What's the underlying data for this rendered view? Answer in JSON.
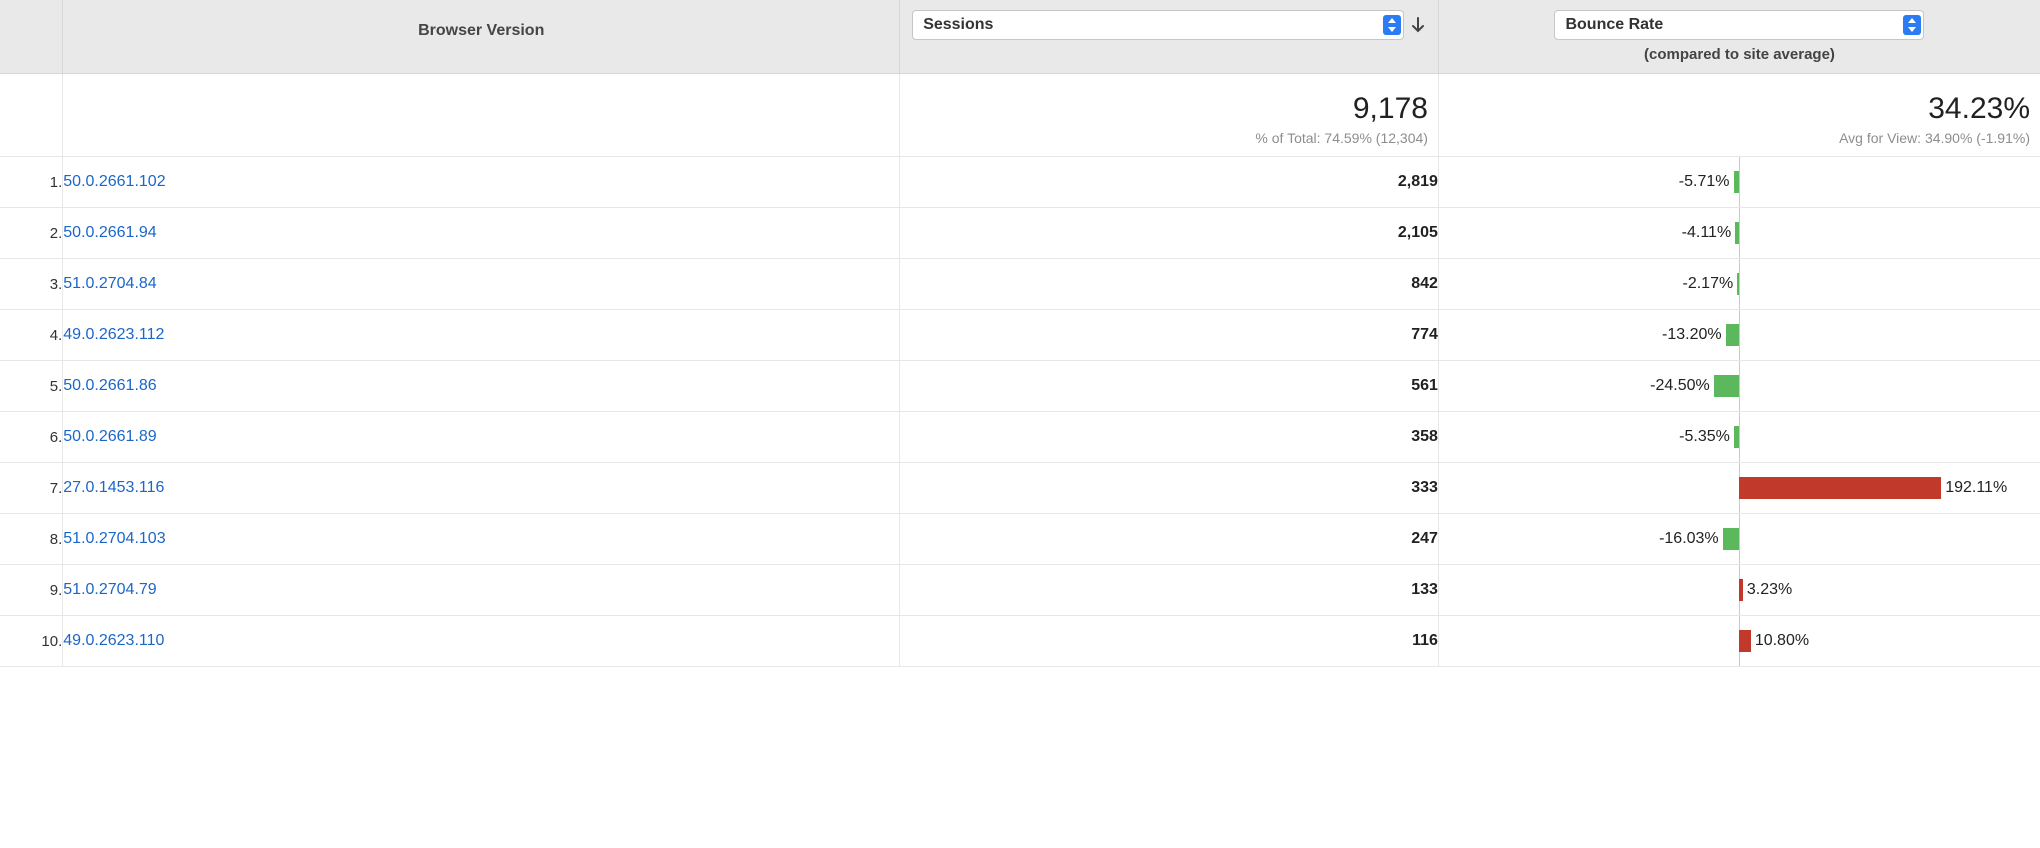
{
  "headers": {
    "version_label": "Browser Version",
    "sessions_select": "Sessions",
    "bounce_select": "Bounce Rate",
    "bounce_sub": "(compared to site average)"
  },
  "summary": {
    "sessions": "9,178",
    "sessions_sub": "% of Total: 74.59% (12,304)",
    "bounce": "34.23%",
    "bounce_sub": "Avg for View: 34.90% (-1.91%)"
  },
  "bounce_bar_max_percent": 200,
  "rows": [
    {
      "index": "1.",
      "version": "50.0.2661.102",
      "sessions": "2,819",
      "bounce_pct": "-5.71%",
      "bar_value": -5.71
    },
    {
      "index": "2.",
      "version": "50.0.2661.94",
      "sessions": "2,105",
      "bounce_pct": "-4.11%",
      "bar_value": -4.11
    },
    {
      "index": "3.",
      "version": "51.0.2704.84",
      "sessions": "842",
      "bounce_pct": "-2.17%",
      "bar_value": -2.17
    },
    {
      "index": "4.",
      "version": "49.0.2623.112",
      "sessions": "774",
      "bounce_pct": "-13.20%",
      "bar_value": -13.2
    },
    {
      "index": "5.",
      "version": "50.0.2661.86",
      "sessions": "561",
      "bounce_pct": "-24.50%",
      "bar_value": -24.5
    },
    {
      "index": "6.",
      "version": "50.0.2661.89",
      "sessions": "358",
      "bounce_pct": "-5.35%",
      "bar_value": -5.35
    },
    {
      "index": "7.",
      "version": "27.0.1453.116",
      "sessions": "333",
      "bounce_pct": "192.11%",
      "bar_value": 192.11
    },
    {
      "index": "8.",
      "version": "51.0.2704.103",
      "sessions": "247",
      "bounce_pct": "-16.03%",
      "bar_value": -16.03
    },
    {
      "index": "9.",
      "version": "51.0.2704.79",
      "sessions": "133",
      "bounce_pct": "3.23%",
      "bar_value": 3.23
    },
    {
      "index": "10.",
      "version": "49.0.2623.110",
      "sessions": "116",
      "bounce_pct": "10.80%",
      "bar_value": 10.8
    }
  ],
  "chart_data": {
    "type": "bar",
    "title": "Bounce Rate (compared to site average)",
    "xlabel": "Browser Version",
    "ylabel": "Bounce Rate Δ vs site average (%)",
    "categories": [
      "50.0.2661.102",
      "50.0.2661.94",
      "51.0.2704.84",
      "49.0.2623.112",
      "50.0.2661.86",
      "50.0.2661.89",
      "27.0.1453.116",
      "51.0.2704.103",
      "51.0.2704.79",
      "49.0.2623.110"
    ],
    "values": [
      -5.71,
      -4.11,
      -2.17,
      -13.2,
      -24.5,
      -5.35,
      192.11,
      -16.03,
      3.23,
      10.8
    ],
    "ylim": [
      -200,
      200
    ]
  }
}
